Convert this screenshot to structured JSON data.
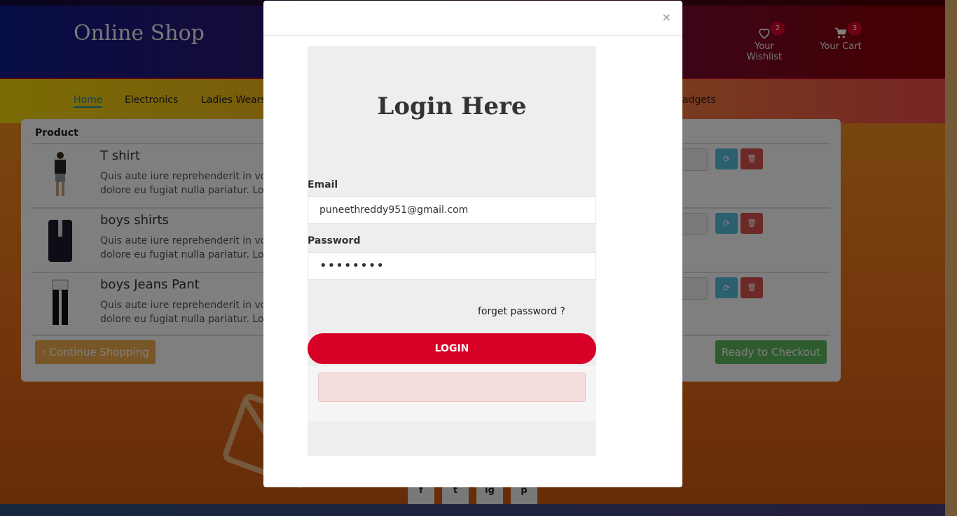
{
  "header": {
    "logo": "Online Shop",
    "wishlist": {
      "label": "Your Wishlist",
      "count": "2"
    },
    "cart": {
      "label": "Your Cart",
      "count": "3"
    }
  },
  "nav": {
    "items": [
      "Home",
      "Electronics",
      "Ladies Wears",
      "adgets"
    ]
  },
  "cart_table": {
    "header": "Product",
    "rows": [
      {
        "name": "T shirt",
        "desc_line1": "Quis aute iure reprehenderit in vo",
        "desc_line2": "dolore eu fugiat nulla pariatur. Lo"
      },
      {
        "name": "boys shirts",
        "desc_line1": "Quis aute iure reprehenderit in vo",
        "desc_line2": "dolore eu fugiat nulla pariatur. Lo"
      },
      {
        "name": "boys Jeans Pant",
        "desc_line1": "Quis aute iure reprehenderit in vo",
        "desc_line2": "dolore eu fugiat nulla pariatur. Lo"
      }
    ],
    "continue_label": "‹ Continue Shopping",
    "checkout_label": "Ready to Checkout"
  },
  "social": [
    "f",
    "t",
    "ig",
    "p"
  ],
  "modal": {
    "close": "×",
    "title": "Login Here",
    "email_label": "Email",
    "email_value": "puneethreddy951@gmail.com",
    "password_label": "Password",
    "password_value": "••••••••",
    "forget": "forget password ?",
    "login_button": "LOGIN"
  },
  "colors": {
    "login_button": "#d70027",
    "badge": "#d90429",
    "nav_active": "#1d8fb3"
  }
}
